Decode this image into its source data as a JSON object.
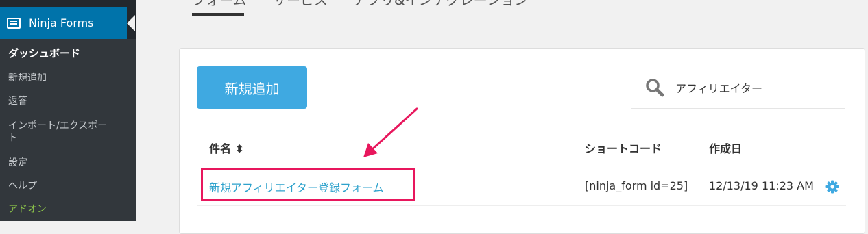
{
  "sidebar": {
    "menu": {
      "label": "Ninja Forms",
      "icon": "form-list-icon"
    },
    "items": [
      {
        "label": "ダッシュボード"
      },
      {
        "label": "新規追加"
      },
      {
        "label": "返答"
      },
      {
        "label": "インポート/エクスポー"
      },
      {
        "label": "ト"
      },
      {
        "label": "設定"
      },
      {
        "label": "ヘルプ"
      },
      {
        "label": "アドオン"
      }
    ]
  },
  "tabs": [
    {
      "label": "フォーム"
    },
    {
      "label": "サービス"
    },
    {
      "label": "アプリ&インテグレーション"
    }
  ],
  "toolbar": {
    "add_new_label": "新規追加"
  },
  "search": {
    "value": "アフィリエイター",
    "icon": "search-icon"
  },
  "table": {
    "headers": {
      "title": "件名 ⬍",
      "shortcode": "ショートコード",
      "date": "作成日"
    },
    "rows": [
      {
        "title": "新規アフィリエイター登録フォーム",
        "shortcode": "[ninja_form id=25]",
        "date": "12/13/19 11:23 AM"
      }
    ]
  },
  "colors": {
    "accent": "#3fa9e1",
    "highlight": "#e8175d",
    "link": "#2ea2cc",
    "sidebar": "#23282d"
  }
}
